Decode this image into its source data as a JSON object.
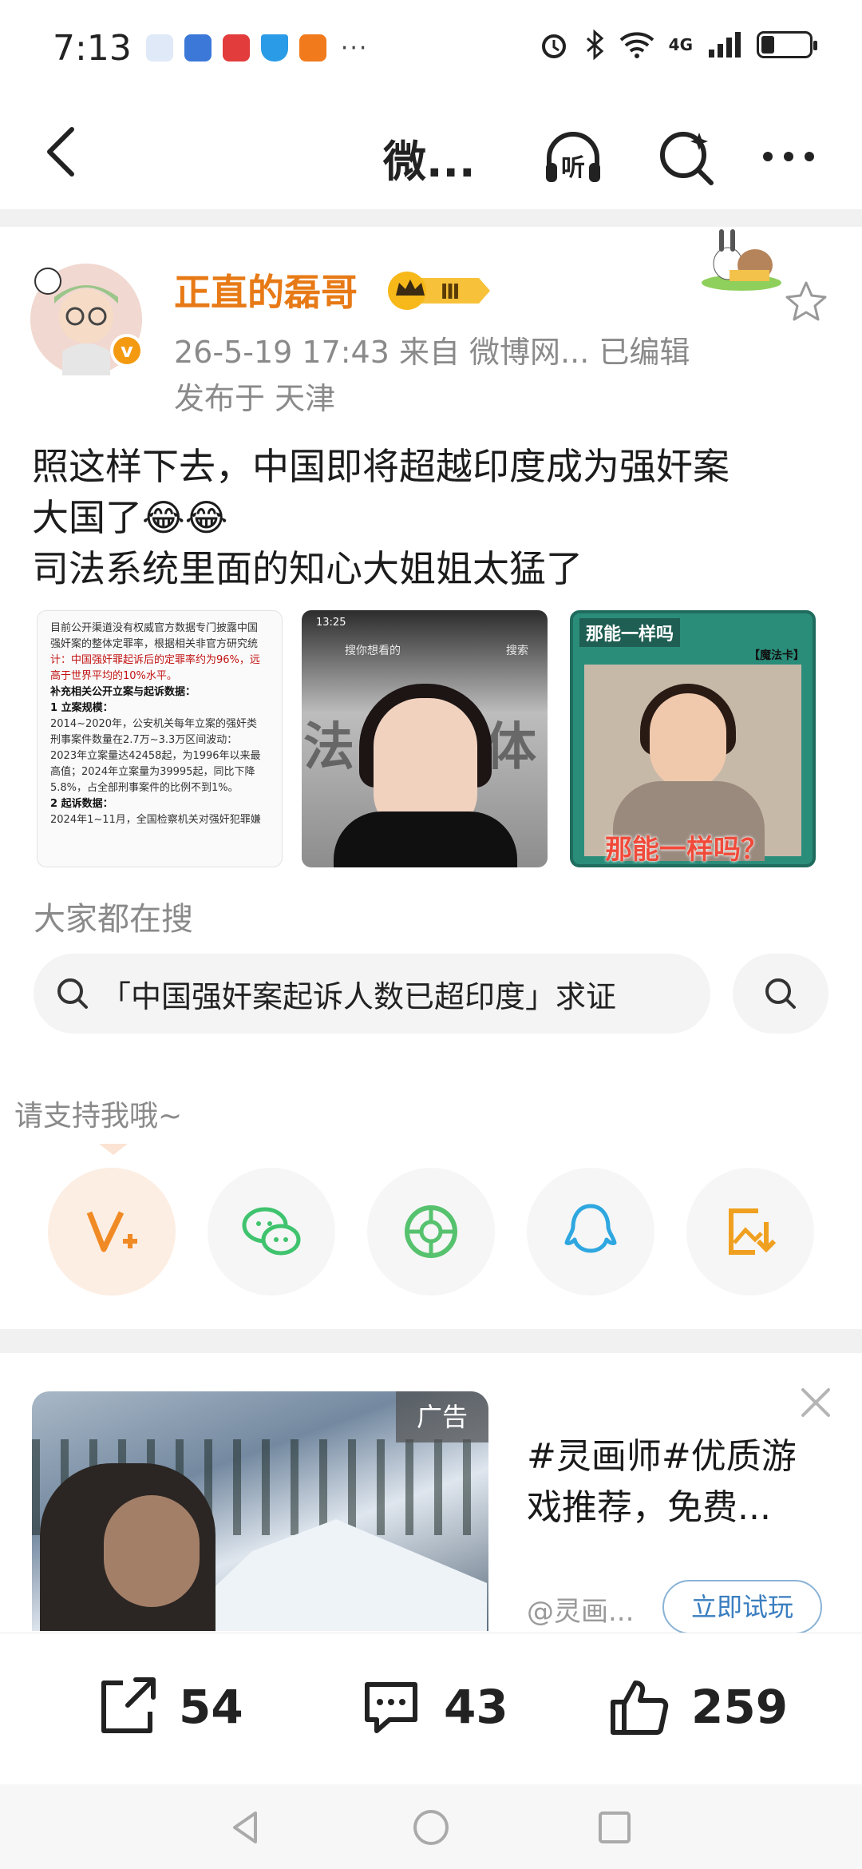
{
  "status_bar": {
    "time": "7:13",
    "network": "4G",
    "dots": "···"
  },
  "nav": {
    "title": "微...",
    "listen_label": "听"
  },
  "post": {
    "user_name": "正直的磊哥",
    "vip_level": "Ⅲ",
    "verified_mark": "v",
    "meta": "26-5-19 17:43  来自 微博网...  已编辑",
    "location": "发布于 天津",
    "text_lines": [
      "照这样下去，中国即将超越印度成为强奸案",
      "大国了😂😂",
      "司法系统里面的知心大姐姐太猛了"
    ],
    "images": {
      "doc": {
        "lines": [
          "目前公开渠道没有权威官方数据专门披露中国",
          "强奸案的整体定罪率，根据相关非官方研究统",
          "计：中国强奸罪起诉后的定罪率约为96%，远",
          "高于世界平均的10%水平。",
          "",
          "补充相关公开立案与起诉数据：",
          "1  立案规模：",
          "   2014~2020年，公安机关每年立案的强奸类",
          "   刑事案件数量在2.7万~3.3万区间波动：",
          "   2023年立案量达42458起，为1996年以来最",
          "   高值；2024年立案量为39995起，同比下降",
          "   5.8%，占全部刑事案件的比例不到1%。",
          "2  起诉数据：",
          "   2024年1~11月，全国检察机关对强奸犯罪嫌"
        ]
      },
      "news": {
        "status_time": "13:25",
        "search_placeholder": "搜你想看的",
        "search_btn": "搜索",
        "bg_text": "法院媒体"
      },
      "card": {
        "title": "那能一样吗",
        "subtitle": "【魔法卡】",
        "caption": "那能一样吗？"
      }
    }
  },
  "search_section": {
    "label": "大家都在搜",
    "query": "「中国强奸案起诉人数已超印度」求证"
  },
  "support": {
    "label": "请支持我哦~",
    "buttons": [
      "v-plus-icon",
      "wechat-icon",
      "moments-icon",
      "qq-icon",
      "save-image-icon"
    ]
  },
  "ad": {
    "badge": "广告",
    "title_lines": [
      "#灵画师#优质游",
      "戏推荐，免费..."
    ],
    "source": "@灵画...",
    "cta": "立即试玩"
  },
  "actions": {
    "repost": "54",
    "comment": "43",
    "like": "259"
  },
  "colors": {
    "username": "#e77a16",
    "accent_orange": "#f39a11",
    "link_blue": "#3a7ec0",
    "wechat_green": "#3fc36e",
    "qq_blue": "#2ea7e0"
  }
}
